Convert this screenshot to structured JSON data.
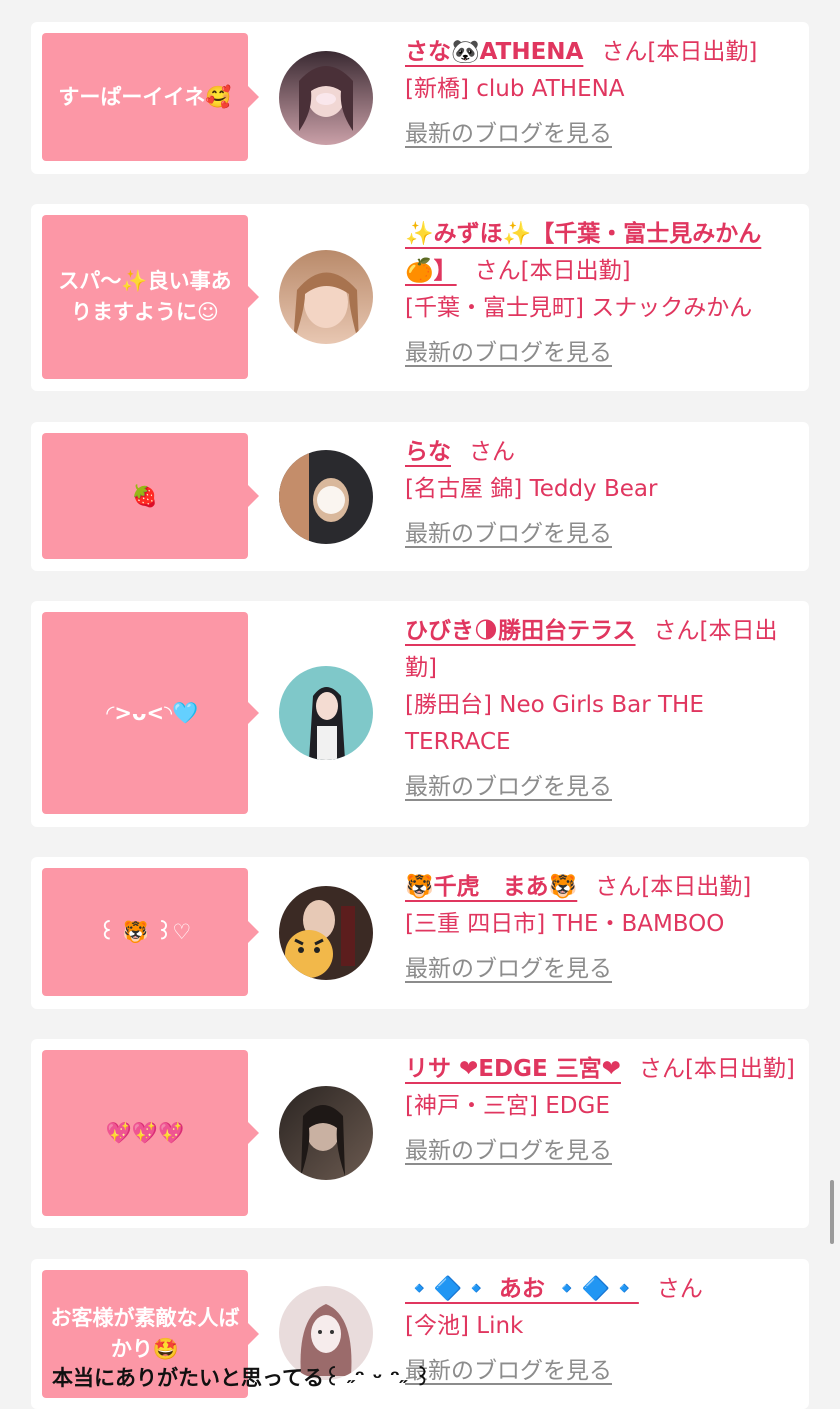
{
  "posts": [
    {
      "comment": "すーぱーイイネ🥰",
      "name": "さな🐼ATHENA",
      "suffix": "さん[本日出勤]",
      "shop": "[新橋] club ATHENA",
      "blog_link": "最新のブログを見る",
      "avatar_colors": [
        "#3a2a32",
        "#caa0a8"
      ]
    },
    {
      "comment": "スパ〜✨良い事ありますように☺",
      "name": "✨みずほ✨【千葉・富士見みかん🍊】",
      "suffix": "さん[本日出勤]",
      "shop": "[千葉・富士見町] スナックみかん",
      "blog_link": "最新のブログを見る",
      "avatar_colors": [
        "#b98a6a",
        "#e8c7b2"
      ]
    },
    {
      "comment": "🍓",
      "name": "らな",
      "suffix": "さん",
      "shop": "[名古屋 錦] Teddy Bear",
      "blog_link": "最新のブログを見る",
      "avatar_colors": [
        "#2a2a2e",
        "#d9b89c"
      ]
    },
    {
      "comment": "︎ ︎ ◜>ᴗ<◝🩵",
      "name": "ひびき🌗勝田台テラス",
      "suffix": "さん[本日出勤]",
      "shop": "[勝田台] Neo Girls Bar THE TERRACE",
      "blog_link": "最新のブログを見る",
      "avatar_colors": [
        "#7fc8c9",
        "#1f1f24"
      ]
    },
    {
      "comment": "꒰ 🐯 ꒱♡",
      "name": "🐯千虎　まあ🐯",
      "suffix": "さん[本日出勤]",
      "shop": "[三重 四日市] THE・BAMBOO",
      "blog_link": "最新のブログを見る",
      "avatar_colors": [
        "#3b2a24",
        "#f2b84a"
      ]
    },
    {
      "comment": "💖💖💖",
      "name": "リサ ❤EDGE 三宮❤",
      "suffix": "さん[本日出勤]",
      "shop": "[神戸・三宮] EDGE",
      "blog_link": "最新のブログを見る",
      "avatar_colors": [
        "#2b2522",
        "#c9b1a2"
      ]
    },
    {
      "comment": "お客様が素敵な人ばかり🤩",
      "name": "🔹🔷🔹 あお 🔹🔷🔹",
      "suffix": "さん",
      "shop": "[今池] Link",
      "blog_link": "最新のブログを見る",
      "avatar_colors": [
        "#e9dcdc",
        "#9b6b6b"
      ]
    }
  ],
  "overlay_caption": "本当にありがたいと思ってる꒰ ˶ᵔ ᵕ ᵔ˶ ꒱"
}
